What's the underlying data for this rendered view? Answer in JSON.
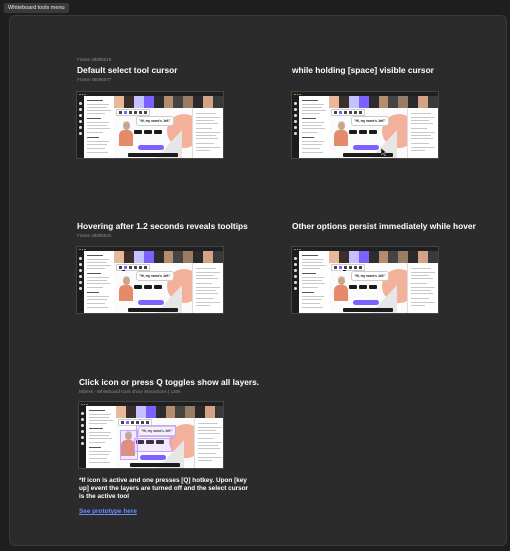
{
  "tab": {
    "label": "Whiteboard tools menu"
  },
  "sections": [
    {
      "caption": "Frame 48096618",
      "title": "Default select tool cursor",
      "subtitle": "Frame 48096077"
    },
    {
      "caption": "",
      "title": "while holding [space] visible cursor",
      "subtitle": ""
    },
    {
      "caption": "",
      "title": "Hovering after 1.2 seconds reveals tooltips",
      "subtitle": "Frame 48096532"
    },
    {
      "caption": "",
      "title": "Other options persist immediately while hover",
      "subtitle": ""
    },
    {
      "caption": "",
      "title": "Click icon or press Q toggles show all layers.",
      "subtitle": "MDesk - Whiteboard tools show interactions | 1366"
    }
  ],
  "speech_text": "\"Hi, my name's Jeff.\"",
  "note": "*If icon is active and one presses [Q] hotkey. Upon [key up] event the layers are turned off and the select cursor is the active tool",
  "prototype_link": "See prototype here",
  "colors": {
    "background": "#1e1e1e",
    "panel": "#2b2b2b",
    "link": "#6b8cff",
    "accent": "#7b61ff",
    "peach": "#f3b09a"
  },
  "icons": [
    "cursor-icon",
    "hand-icon"
  ]
}
